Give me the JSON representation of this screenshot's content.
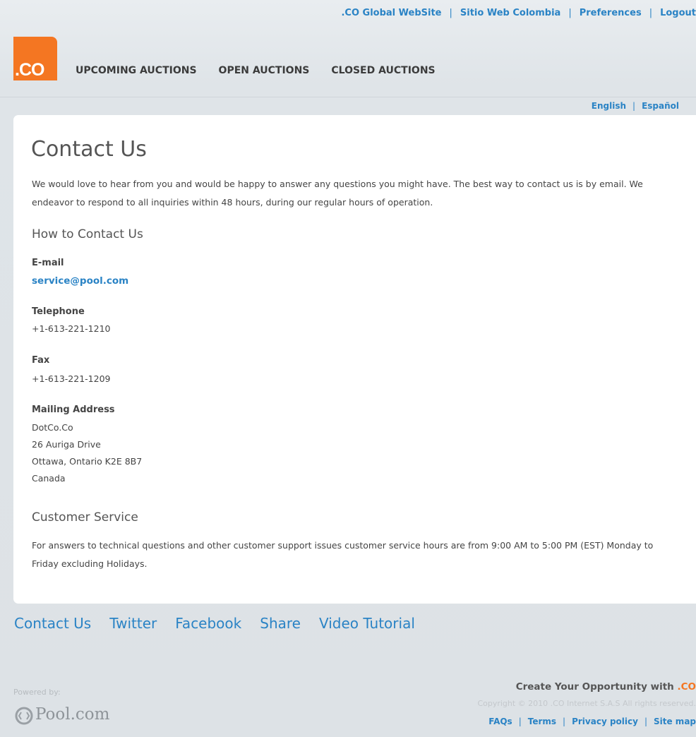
{
  "top_links": [
    ".CO Global WebSite",
    "Sitio Web Colombia",
    "Preferences",
    "Logout"
  ],
  "logo_text": ".CO",
  "nav": [
    "UPCOMING AUCTIONS",
    "OPEN AUCTIONS",
    "CLOSED AUCTIONS"
  ],
  "languages": [
    "English",
    "Español"
  ],
  "page": {
    "title": "Contact Us",
    "intro": "We would love to hear from you and would be happy to answer any questions you might have. The best way to contact us is by email. We endeavor to respond to all inquiries within 48 hours, during our regular hours of operation.",
    "how_heading": "How to Contact Us",
    "email_label": "E-mail",
    "email": "service@pool.com",
    "telephone_label": "Telephone",
    "telephone": "+1-613-221-1210",
    "fax_label": "Fax",
    "fax": "+1-613-221-1209",
    "mailing_label": "Mailing Address",
    "address": [
      "DotCo.Co",
      "26 Auriga Drive",
      "Ottawa, Ontario K2E 8B7",
      "Canada"
    ],
    "service_heading": "Customer Service",
    "service_text": "For answers to technical questions and other customer support issues customer service hours are from 9:00 AM to 5:00 PM (EST) Monday to Friday excluding Holidays."
  },
  "footer_nav": [
    "Contact Us",
    "Twitter",
    "Facebook",
    "Share",
    "Video Tutorial"
  ],
  "footer": {
    "powered_by": "Powered by:",
    "pool_logo": "Pool.com",
    "tagline": "Create Your Opportunity with",
    "tagline_brand": ".CO",
    "copyright": "Copyright © 2010 .CO Internet S.A.S All rights reserved.",
    "links": [
      "FAQs",
      "Terms",
      "Privacy policy",
      "Site map"
    ]
  },
  "colors": {
    "accent": "#2a83c5",
    "brand": "#f47622"
  }
}
